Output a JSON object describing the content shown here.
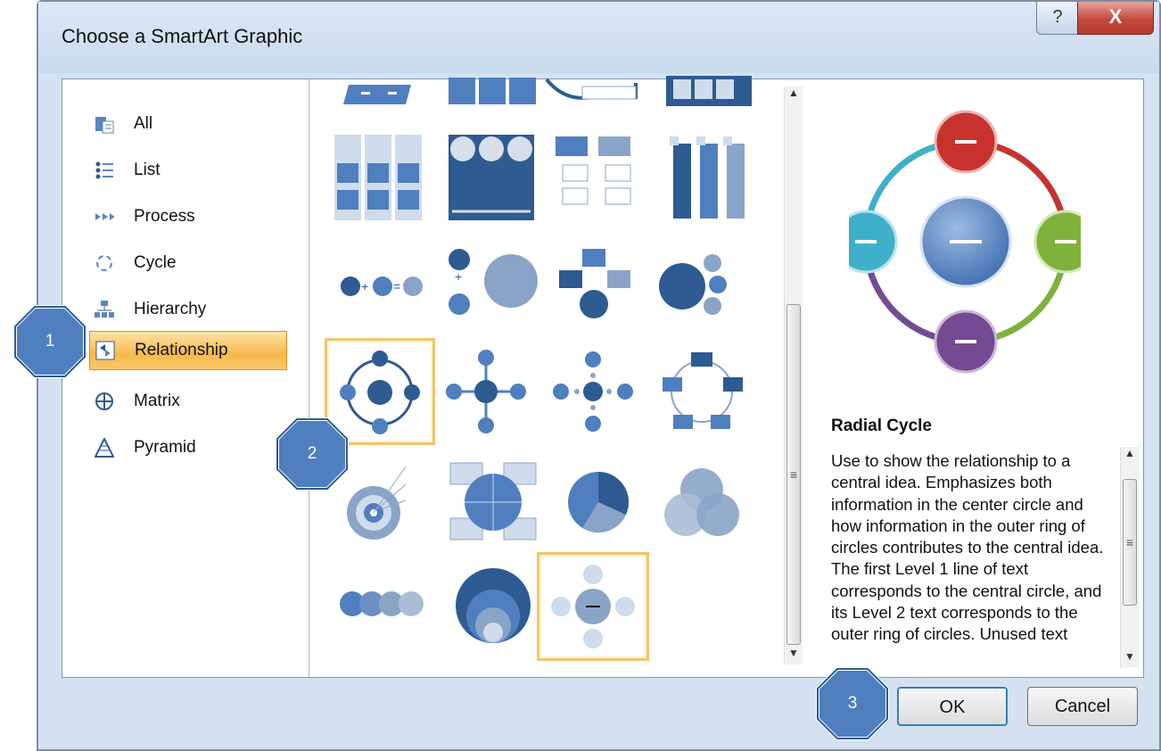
{
  "dialog": {
    "title": "Choose a SmartArt Graphic",
    "help_label": "?",
    "close_label": "X"
  },
  "categories": [
    {
      "label": "All",
      "icon": "all-icon",
      "selected": false
    },
    {
      "label": "List",
      "icon": "list-icon",
      "selected": false
    },
    {
      "label": "Process",
      "icon": "process-icon",
      "selected": false
    },
    {
      "label": "Cycle",
      "icon": "cycle-icon",
      "selected": false
    },
    {
      "label": "Hierarchy",
      "icon": "hierarchy-icon",
      "selected": false
    },
    {
      "label": "Relationship",
      "icon": "relationship-icon",
      "selected": true
    },
    {
      "label": "Matrix",
      "icon": "matrix-icon",
      "selected": false
    },
    {
      "label": "Pyramid",
      "icon": "pyramid-icon",
      "selected": false
    }
  ],
  "gallery": {
    "layouts": [
      "counterbalance-arrows",
      "equation-blocks",
      "funnel-card",
      "tab-stack",
      "stacked-list",
      "vertical-circle-list",
      "hierarchy-list",
      "tall-bar-list",
      "equation",
      "plus-arrow-circle",
      "converging-boxes",
      "bending-circle-list",
      "radial-cycle",
      "basic-radial",
      "diverging-radial",
      "segmented-cycle",
      "target",
      "matrix-circles",
      "pie",
      "venn",
      "linear-venn",
      "nested-target",
      "radial-venn"
    ],
    "selected": "radial-cycle"
  },
  "preview": {
    "title": "Radial Cycle",
    "description": "Use to show the relationship to a central idea. Emphasizes both information in the center circle and how information in the outer ring of circles contributes to the central idea. The first Level 1 line of text corresponds to the central circle, and its Level 2 text corresponds to the outer ring of circles. Unused text",
    "colors": {
      "top": "#c7332c",
      "right": "#7fb23a",
      "bottom": "#744a92",
      "left": "#3fb0c9",
      "center": "#4f7fbf"
    }
  },
  "buttons": {
    "ok": "OK",
    "cancel": "Cancel"
  },
  "markers": [
    "1",
    "2",
    "3"
  ],
  "colors": {
    "accent": "#4f7fbf",
    "selection": "#f7b84d",
    "marker": "#4f7fbf"
  }
}
